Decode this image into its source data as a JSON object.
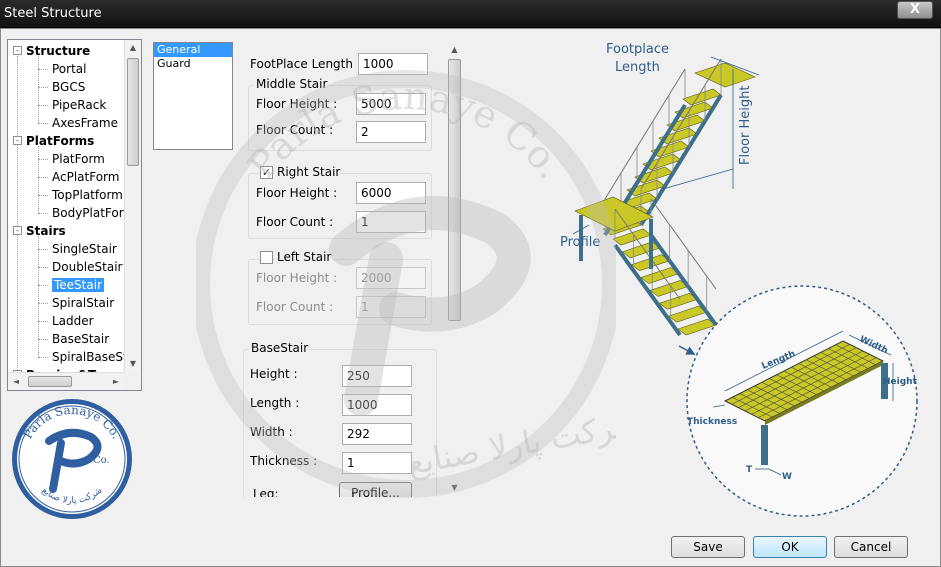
{
  "window": {
    "title": "Steel Structure",
    "close_label": "X"
  },
  "tree": {
    "categories": [
      {
        "label": "Structure",
        "items": [
          "Portal",
          "BGCS",
          "PipeRack",
          "AxesFrame"
        ]
      },
      {
        "label": "PlatForms",
        "items": [
          "PlatForm",
          "AcPlatForm",
          "TopPlatform",
          "BodyPlatForm"
        ]
      },
      {
        "label": "Stairs",
        "items": [
          "SingleStair",
          "DoubleStair",
          "TeeStair",
          "SpiralStair",
          "Ladder",
          "BaseStair",
          "SpiralBaseStair"
        ]
      },
      {
        "label": "Bracing&Truss",
        "items": []
      }
    ],
    "selected": "TeeStair",
    "expander": "-",
    "scroll_up": "▲",
    "scroll_down": "▼",
    "scroll_left": "◄",
    "scroll_right": "►"
  },
  "list": {
    "items": [
      "General",
      "Guard"
    ],
    "selected": "General"
  },
  "form": {
    "footplace_label": "FootPlace Length :",
    "footplace_value": "1000",
    "middle": {
      "title": "Middle Stair",
      "height_label": "Floor Height :",
      "height_value": "5000",
      "count_label": "Floor Count :",
      "count_value": "2"
    },
    "right": {
      "title": "Right Stair",
      "checked": true,
      "check_mark": "✓",
      "height_label": "Floor Height :",
      "height_value": "6000",
      "count_label": "Floor Count  :",
      "count_value": "1"
    },
    "left": {
      "title": "Left Stair",
      "checked": false,
      "height_label": "Floor Height :",
      "height_value": "2000",
      "count_label": "Floor Count :",
      "count_value": "1"
    },
    "base": {
      "title": "BaseStair",
      "height_label": "Height :",
      "height_value": "250",
      "length_label": "Length :",
      "length_value": "1000",
      "width_label": "Width :",
      "width_value": "292",
      "thickness_label": "Thickness :",
      "thickness_value": "1",
      "leg_label": "Leg:",
      "profile_button": "Profile..."
    },
    "scroll_up": "▲",
    "scroll_down": "▼"
  },
  "illustration": {
    "labels": {
      "footplace": "Footplace",
      "length1": "Length",
      "floor_height": "Floor Height",
      "profile": "Profile",
      "length2": "Length",
      "width": "Width",
      "height": "Height",
      "thickness": "Thickness",
      "t": "T",
      "w": "W"
    },
    "colors": {
      "tread": "#c9c826",
      "steel": "#3d6e8a",
      "label": "#2f5d8a",
      "watermark": "#b8b8b8"
    }
  },
  "logo": {
    "top_text": "Parla Sanaye Co.",
    "bottom_text": "شرکت پارلا صنایع",
    "mark": "Co."
  },
  "watermark": {
    "text": "Parla Sanaye Co.",
    "text_fa": "شرکت پارلا صنایع"
  },
  "footer": {
    "save": "Save",
    "ok": "OK",
    "cancel": "Cancel"
  }
}
